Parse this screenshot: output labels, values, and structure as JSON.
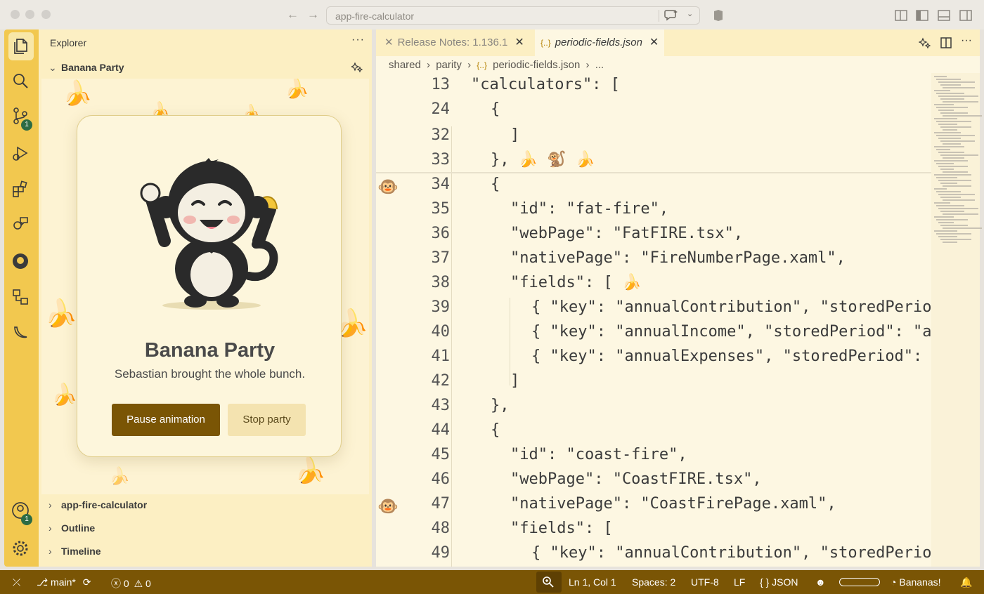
{
  "window": {
    "command_center": "app-fire-calculator"
  },
  "sidebar": {
    "title": "Explorer",
    "more": "···",
    "party_section": "Banana Party",
    "party_card": {
      "title": "Banana Party",
      "subtitle": "Sebastian brought the whole bunch.",
      "pause_label": "Pause animation",
      "stop_label": "Stop party"
    },
    "sections": [
      "app-fire-calculator",
      "Outline",
      "Timeline"
    ]
  },
  "activity_badges": {
    "source_control": "1",
    "accounts": "1"
  },
  "tabs": [
    {
      "label": "Release Notes: 1.136.1",
      "active": false
    },
    {
      "label": "periodic-fields.json",
      "active": true
    }
  ],
  "breadcrumb": [
    "shared",
    "parity",
    "periodic-fields.json",
    "..."
  ],
  "code_lines": [
    {
      "n": "13",
      "text": "\"calculators\": ["
    },
    {
      "n": "24",
      "text": "{"
    },
    {
      "n": "32",
      "text": "]"
    },
    {
      "n": "33",
      "text": "}, 🍌 🐒 🍌"
    },
    {
      "n": "34",
      "text": "{"
    },
    {
      "n": "35",
      "text": "\"id\": \"fat-fire\","
    },
    {
      "n": "36",
      "text": "\"webPage\": \"FatFIRE.tsx\","
    },
    {
      "n": "37",
      "text": "\"nativePage\": \"FireNumberPage.xaml\","
    },
    {
      "n": "38",
      "text": "\"fields\": [ 🍌"
    },
    {
      "n": "39",
      "text": "{ \"key\": \"annualContribution\", \"storedPeriod\""
    },
    {
      "n": "40",
      "text": "{ \"key\": \"annualIncome\", \"storedPeriod\": \"ann"
    },
    {
      "n": "41",
      "text": "{ \"key\": \"annualExpenses\", \"storedPeriod\": \"a"
    },
    {
      "n": "42",
      "text": "]"
    },
    {
      "n": "43",
      "text": "},"
    },
    {
      "n": "44",
      "text": "{"
    },
    {
      "n": "45",
      "text": "\"id\": \"coast-fire\","
    },
    {
      "n": "46",
      "text": "\"webPage\": \"CoastFIRE.tsx\","
    },
    {
      "n": "47",
      "text": "\"nativePage\": \"CoastFirePage.xaml\","
    },
    {
      "n": "48",
      "text": "\"fields\": ["
    },
    {
      "n": "49",
      "text": "{ \"key\": \"annualContribution\", \"storedPeriod\""
    }
  ],
  "status": {
    "branch": "main*",
    "errors": "0",
    "warnings": "0",
    "position": "Ln 1, Col 1",
    "spaces": "Spaces: 2",
    "encoding": "UTF-8",
    "eol": "LF",
    "language": "JSON",
    "bananas": "Bananas!"
  },
  "colors": {
    "activity_bar": "#f2c84f",
    "sidebar": "#fcefc3",
    "editor": "#fdf7e2",
    "status_bar": "#7a5505",
    "pause_button": "#7a5505"
  }
}
